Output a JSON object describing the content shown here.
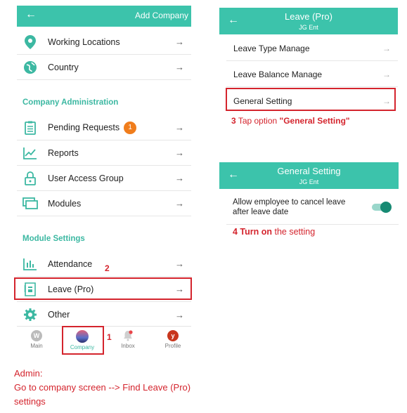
{
  "left_phone": {
    "header_title": "Add Company",
    "rows_top": [
      {
        "label": "Working Locations",
        "icon": "location-pin-icon"
      },
      {
        "label": "Country",
        "icon": "globe-icon"
      }
    ],
    "section_admin": "Company Administration",
    "rows_admin": [
      {
        "label": "Pending Requests",
        "icon": "clipboard-icon",
        "badge": "1"
      },
      {
        "label": "Reports",
        "icon": "chart-icon"
      },
      {
        "label": "User Access Group",
        "icon": "lock-icon"
      },
      {
        "label": "Modules",
        "icon": "monitor-icon"
      }
    ],
    "section_modules": "Module Settings",
    "rows_modules": [
      {
        "label": "Attendance",
        "icon": "bar-chart-icon"
      },
      {
        "label": "Leave (Pro)",
        "icon": "leave-doc-icon"
      },
      {
        "label": "Other",
        "icon": "gear-icon"
      }
    ],
    "bottom_nav": [
      {
        "label": "Main",
        "letter": "W"
      },
      {
        "label": "Company"
      },
      {
        "label": "Inbox"
      },
      {
        "label": "Profile",
        "letter": "y"
      }
    ]
  },
  "steps": {
    "step1": "1",
    "step2": "2",
    "step3_num": "3",
    "step3_text": "Tap option ",
    "step3_quote": "\"General Setting\"",
    "step4_bold": "4 Turn on",
    "step4_text": " the setting"
  },
  "leave_screen": {
    "title": "Leave (Pro)",
    "subtitle": "JG Ent",
    "rows": [
      "Leave Type Manage",
      "Leave Balance Manage",
      "General Setting"
    ]
  },
  "general_screen": {
    "title": "General Setting",
    "subtitle": "JG Ent",
    "toggle_label_line1": "Allow employee to cancel leave",
    "toggle_label_line2": "after leave date",
    "toggle_on": true
  },
  "instructions": {
    "line1": "Admin:",
    "line2": "Go to company screen --> Find Leave (Pro)",
    "line3": "settings"
  },
  "colors": {
    "teal": "#3cc3ab",
    "red": "#d4242d",
    "badge": "#f07d1c"
  }
}
